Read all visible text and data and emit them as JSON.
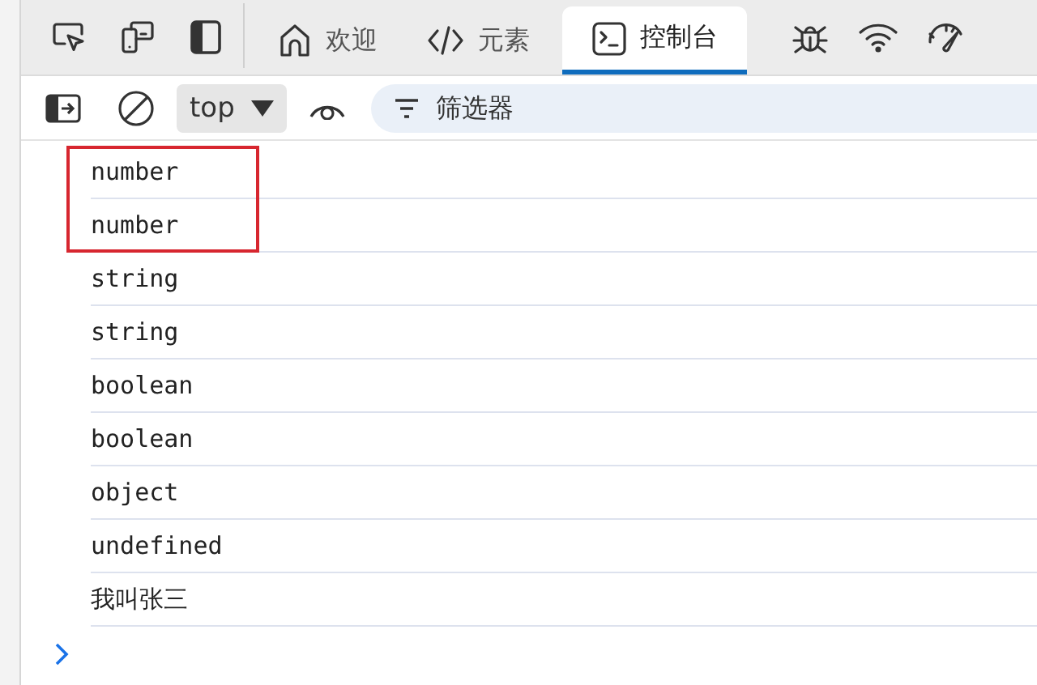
{
  "tabs": [
    {
      "kind": "home",
      "label": "欢迎",
      "selected": false
    },
    {
      "kind": "code",
      "label": "元素",
      "selected": false
    },
    {
      "kind": "console",
      "label": "控制台",
      "selected": true
    }
  ],
  "toolbar": {
    "context": "top",
    "filter": {
      "placeholder": "筛选器"
    }
  },
  "console": {
    "rows": [
      {
        "text": "number",
        "highlighted": true
      },
      {
        "text": "number",
        "highlighted": true
      },
      {
        "text": "string",
        "highlighted": false
      },
      {
        "text": "string",
        "highlighted": false
      },
      {
        "text": "boolean",
        "highlighted": false
      },
      {
        "text": "boolean",
        "highlighted": false
      },
      {
        "text": "object",
        "highlighted": false
      },
      {
        "text": "undefined",
        "highlighted": false
      },
      {
        "text": "我叫张三",
        "highlighted": false
      }
    ]
  }
}
